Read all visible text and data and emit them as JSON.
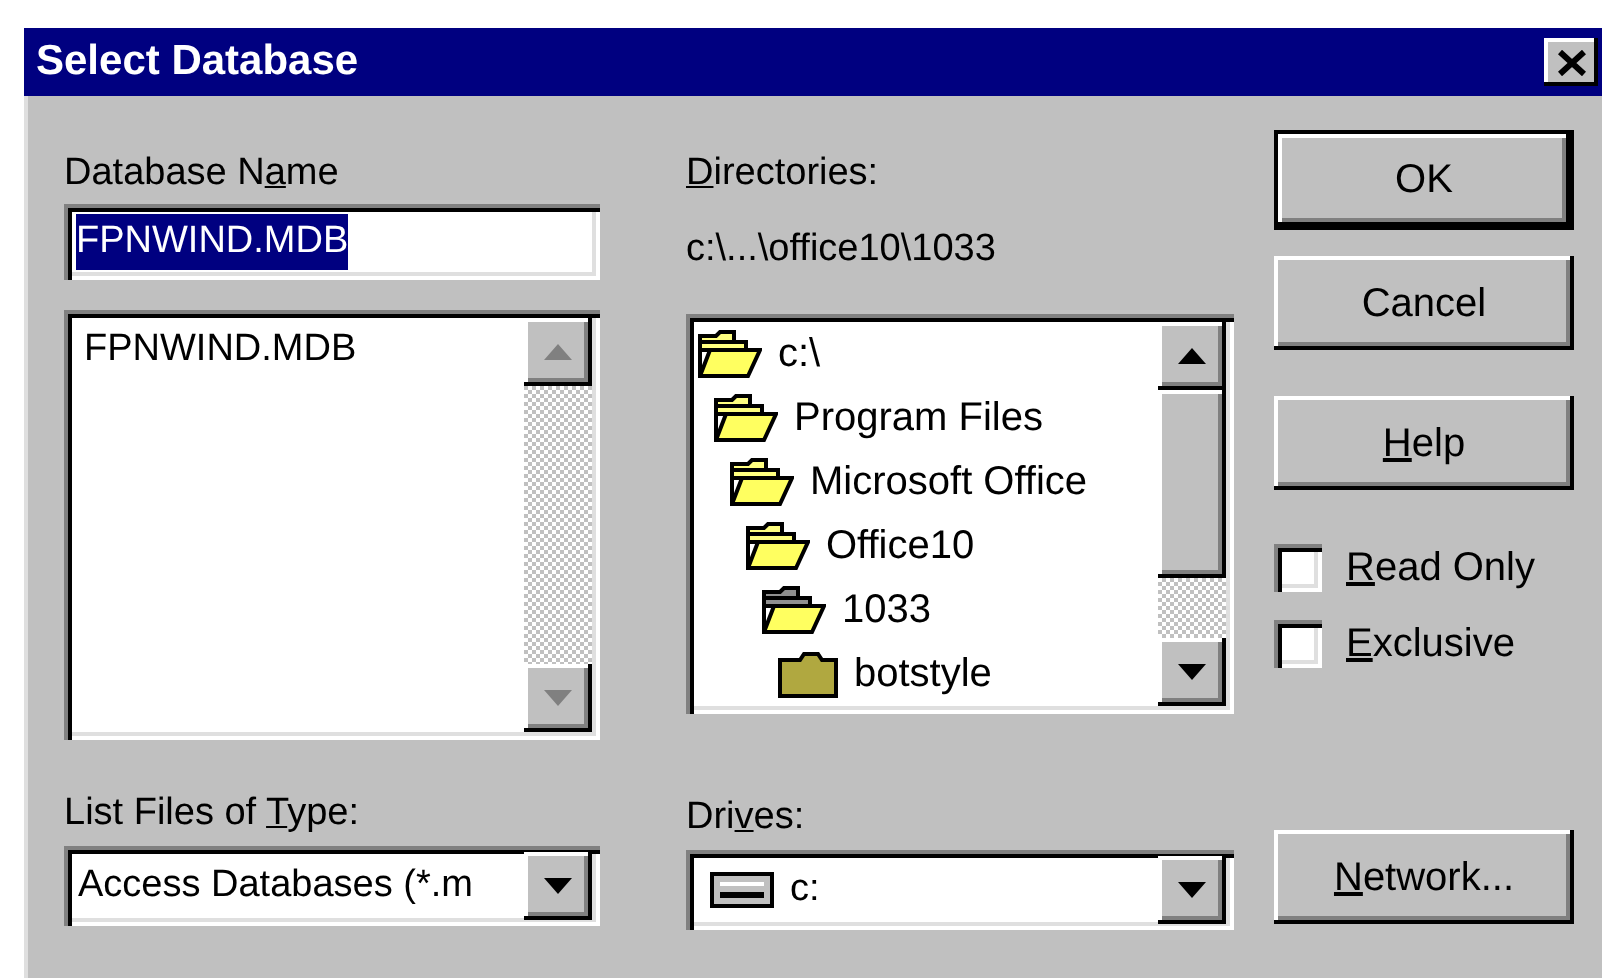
{
  "window": {
    "title": "Select Database"
  },
  "database_name": {
    "label": {
      "before": "Database N",
      "key": "a",
      "after": "me"
    },
    "value": "FPNWIND.MDB",
    "value_selected": true
  },
  "files": [
    {
      "name": "FPNWIND.MDB",
      "selected": false
    }
  ],
  "file_type": {
    "label": {
      "before": "List Files of ",
      "key": "T",
      "after": "ype:"
    },
    "value": "Access Databases (*.m"
  },
  "directories": {
    "label": {
      "key": "D",
      "after": "irectories:"
    },
    "path": "c:\\...\\office10\\1033",
    "tree": [
      {
        "name": "c:\\",
        "kind": "open",
        "children": [
          {
            "name": "Program Files",
            "kind": "open",
            "children": [
              {
                "name": "Microsoft Office",
                "kind": "open",
                "children": [
                  {
                    "name": "Office10",
                    "kind": "open",
                    "children": [
                      {
                        "name": "1033",
                        "kind": "current",
                        "children": [
                          {
                            "name": "botstyle",
                            "kind": "closed"
                          }
                        ]
                      }
                    ]
                  }
                ]
              }
            ]
          }
        ]
      }
    ]
  },
  "drives": {
    "label": {
      "before": "Dri",
      "key": "v",
      "after": "es:"
    },
    "value": "c:"
  },
  "buttons": [
    {
      "label": {
        "before": "OK"
      },
      "default": true
    },
    {
      "label": {
        "before": "Cancel"
      },
      "default": false
    },
    {
      "label": {
        "key": "H",
        "after": "elp"
      },
      "default": false
    }
  ],
  "options": [
    {
      "label": {
        "key": "R",
        "after": "ead Only"
      },
      "checked": false
    },
    {
      "label": {
        "key": "E",
        "after": "xclusive"
      },
      "checked": false
    }
  ],
  "network_button": {
    "label": {
      "key": "N",
      "after": "etwork..."
    }
  }
}
